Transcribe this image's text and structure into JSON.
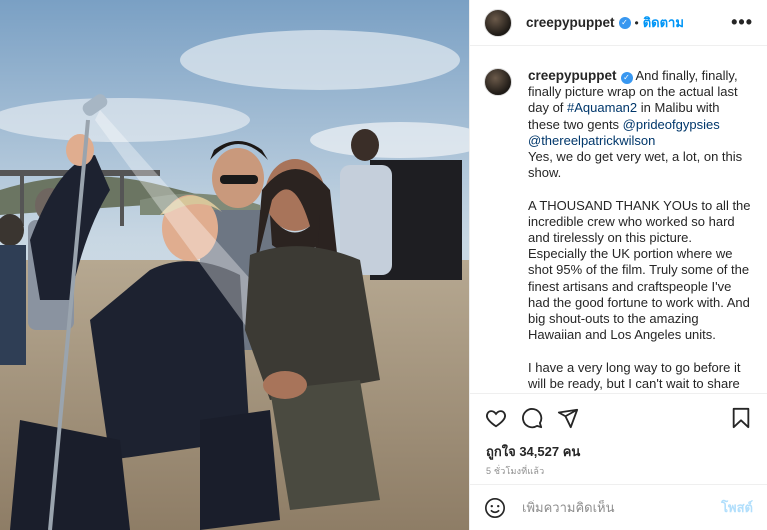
{
  "post": {
    "username": "creepypuppet",
    "follow_label": "ติดตาม",
    "separator": "•",
    "more_label": "•••",
    "caption": {
      "line1_text": "And finally, finally, finally picture wrap on the actual last day of ",
      "hashtag": "#Aquaman2",
      "line1_after_hashtag": " in Malibu with these two gents ",
      "mention1": "@prideofgypsies",
      "mention2": "@thereelpatrickwilson",
      "p2": "Yes, we do get very wet, a lot, on this show.",
      "p3": "A THOUSAND THANK YOUs to all the incredible crew who worked so hard and tirelessly on this picture. Especially the UK portion where we shot 95% of the film. Truly some of the finest artisans and craftspeople I've had the good fortune to work with. And big shout-outs to the amazing Hawaiian and Los Angeles units.",
      "p4": "I have a very long way to go before it will be ready, but I can't wait to share this little film with y'all."
    },
    "likes_label": "ถูกใจ 34,527 คน",
    "time_label": "5 ชั่วโมงที่แล้ว",
    "comment_placeholder": "เพิ่มความคิดเห็น",
    "post_button_label": "โพสต์",
    "icons": {
      "like": "heart-icon",
      "comment": "comment-icon",
      "share": "send-icon",
      "save": "bookmark-icon",
      "emoji": "smiley-icon"
    },
    "colors": {
      "link": "#00376b",
      "accent": "#0095f6",
      "verified": "#3897f0",
      "post_disabled": "#b2dffc"
    }
  }
}
